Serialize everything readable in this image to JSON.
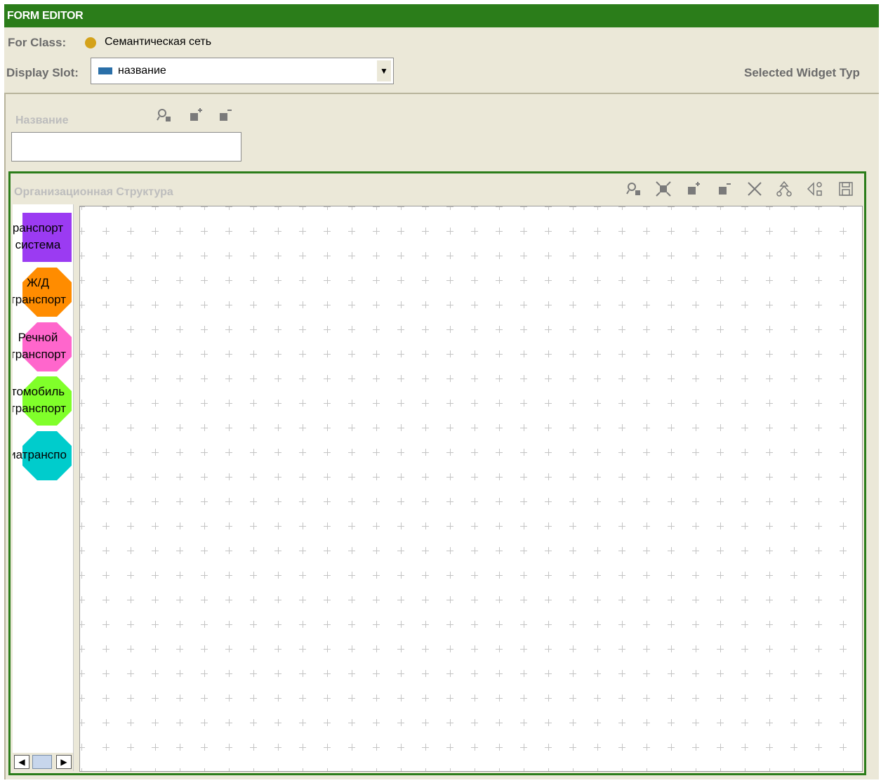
{
  "window": {
    "title": "FORM EDITOR"
  },
  "header": {
    "class_label": "For Class:",
    "class_name": "Семантическая сеть",
    "slot_label": "Display Slot:",
    "slot_value": "название",
    "selected_widget_label": "Selected Widget Typ"
  },
  "name_field": {
    "label": "Название",
    "value": "",
    "toolbar": [
      "find-icon",
      "add-instance-icon",
      "remove-instance-icon"
    ]
  },
  "org_structure": {
    "label": "Организационная Структура",
    "toolbar": [
      "find-icon",
      "select-all-icon",
      "add-instance-icon",
      "remove-instance-icon",
      "delete-icon",
      "layout-icon",
      "connect-icon",
      "save-icon"
    ],
    "palette": [
      {
        "label": "ранспорт\nсистема",
        "color": "#9b3bf2",
        "shape": "rectangle"
      },
      {
        "label": "Ж/Д\nтранспорт",
        "color": "#ff8c00",
        "shape": "octagon"
      },
      {
        "label": "Речной\nтранспорт",
        "color": "#ff66cc",
        "shape": "octagon"
      },
      {
        "label": "томобиль\nтранспорт",
        "color": "#80ff2a",
        "shape": "octagon"
      },
      {
        "label": "иатранспо",
        "color": "#00cccc",
        "shape": "octagon"
      }
    ]
  },
  "colors": {
    "title_bar": "#2b7d1a",
    "panel_border": "#2b7d1a",
    "background": "#ebe8d8",
    "class_dot": "#d4a21a",
    "slot_icon": "#2a6fa8"
  }
}
